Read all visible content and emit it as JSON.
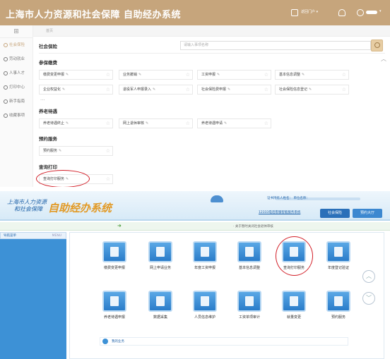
{
  "top": {
    "header": {
      "title": "上海市人力资源和社会保障 自助经办系统",
      "portal_button": "返回门户 ▾",
      "user_menu": "▾"
    },
    "sidebar": {
      "items": [
        {
          "label": "社会保险",
          "active": true
        },
        {
          "label": "劳动就业"
        },
        {
          "label": "人事人才"
        },
        {
          "label": "打印中心"
        },
        {
          "label": "新手指南"
        },
        {
          "label": "收藏事项"
        }
      ]
    },
    "breadcrumb": "首页",
    "section_title": "社会保险",
    "search": {
      "placeholder": "请输入事项名称"
    },
    "groups": [
      {
        "title": "参保缴费",
        "items": [
          "缴费变更申报",
          "业务撤销",
          "工资申报",
          "基本信息调整",
          "企业权益化",
          "退役军人申报录入",
          "社会保险费申报",
          "社会保险信息登记"
        ],
        "more": "···"
      },
      {
        "title": "养老待遇",
        "items": [
          "养老待遇终止",
          "网上退休审核",
          "养老待遇申请"
        ]
      },
      {
        "title": "预约服务",
        "items": [
          "预约服务"
        ]
      },
      {
        "title": "查询打印",
        "items": [
          "查询打印服务"
        ]
      }
    ],
    "highlight_color": "#d21d26",
    "accent_color": "#c6a57c"
  },
  "bottom": {
    "header": {
      "line1": "上海市人力资源",
      "line2": "和社会保障",
      "title": "自助经办系统",
      "user_info": "证书持有人姓名：        单位名称：",
      "link": "12333电话客服智能服务系统",
      "tab_social": "社会保险",
      "tab_hall": "预约大厅"
    },
    "notice": "· 关于暂时关闭社会退休审核",
    "sidebar": {
      "title": "导航菜单",
      "toggle": "MENU"
    },
    "icons_row1": [
      "缴费变更申报",
      "网上申请业务",
      "年度工资申报",
      "基本信息调整",
      "查询打印服务",
      "年度登记验证"
    ],
    "icons_row2": [
      "养老待遇申报",
      "数据采集",
      "人员信息维护",
      "工资单项审计",
      "就量变更",
      "预约服务"
    ],
    "my_business": "我的业务",
    "scroll_up": "︿",
    "scroll_down": "﹀"
  }
}
